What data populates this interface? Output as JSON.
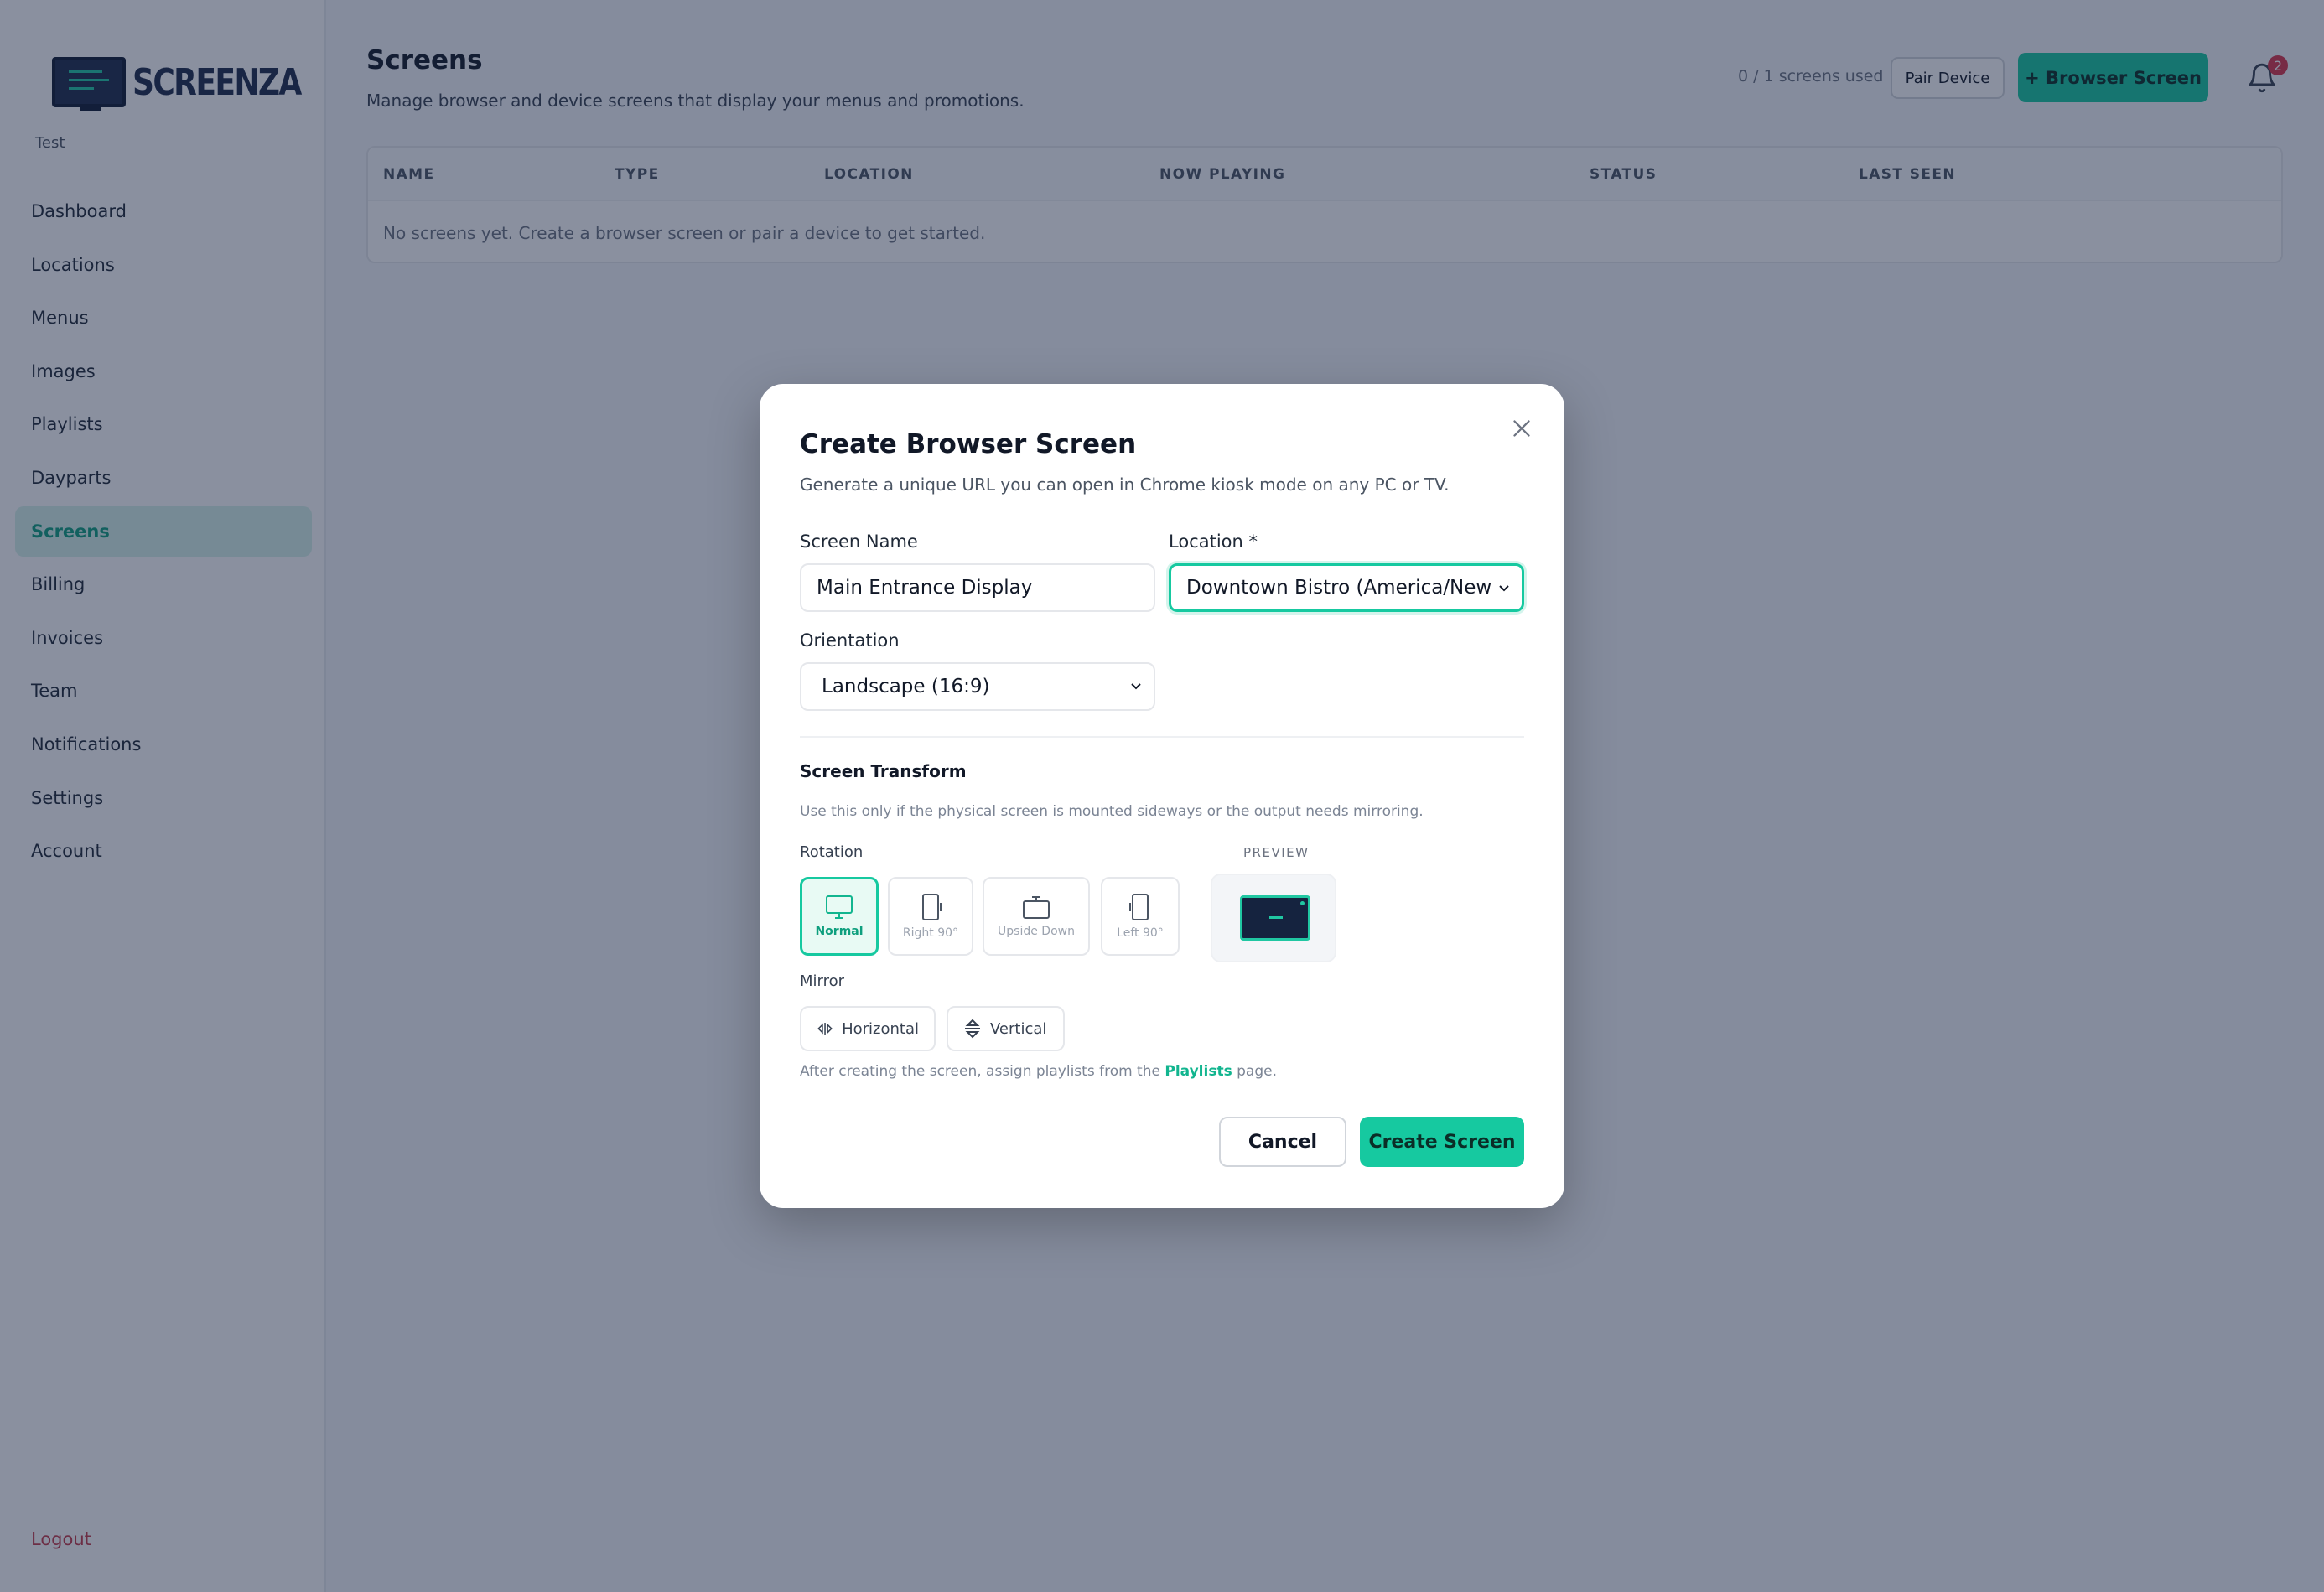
{
  "app": {
    "brand": "SCREENZA",
    "org_name": "Test",
    "accent_color": "#16c9a0"
  },
  "sidebar": {
    "items": [
      {
        "label": "Dashboard"
      },
      {
        "label": "Locations"
      },
      {
        "label": "Menus"
      },
      {
        "label": "Images"
      },
      {
        "label": "Playlists"
      },
      {
        "label": "Dayparts"
      },
      {
        "label": "Screens",
        "active": true
      },
      {
        "label": "Billing"
      },
      {
        "label": "Invoices"
      },
      {
        "label": "Team"
      },
      {
        "label": "Notifications"
      },
      {
        "label": "Settings"
      },
      {
        "label": "Account"
      }
    ],
    "logout": "Logout"
  },
  "header": {
    "title": "Screens",
    "subtitle": "Manage browser and device screens that display your menus and promotions.",
    "usage": "0 / 1 screens used",
    "pair_device": "Pair Device",
    "browser_screen": "+ Browser Screen",
    "notification_count": "2"
  },
  "table": {
    "columns": [
      "NAME",
      "TYPE",
      "LOCATION",
      "NOW PLAYING",
      "STATUS",
      "LAST SEEN"
    ],
    "empty_message": "No screens yet. Create a browser screen or pair a device to get started."
  },
  "modal": {
    "title": "Create Browser Screen",
    "subtitle": "Generate a unique URL you can open in Chrome kiosk mode on any PC or TV.",
    "screen_name_label": "Screen Name",
    "screen_name_value": "Main Entrance Display",
    "location_label": "Location *",
    "location_value": "Downtown Bistro (America/New",
    "orientation_label": "Orientation",
    "orientation_value": "Landscape (16:9)",
    "transform_title": "Screen Transform",
    "transform_help": "Use this only if the physical screen is mounted sideways or the output needs mirroring.",
    "rotation_label": "Rotation",
    "rotations": [
      {
        "label": "Normal",
        "selected": true
      },
      {
        "label": "Right 90°"
      },
      {
        "label": "Upside Down"
      },
      {
        "label": "Left 90°"
      }
    ],
    "preview_label": "PREVIEW",
    "mirror_label": "Mirror",
    "mirror_options": [
      "Horizontal",
      "Vertical"
    ],
    "footnote_prefix": "After creating the screen, assign playlists from the ",
    "footnote_link": "Playlists",
    "footnote_suffix": " page.",
    "cancel": "Cancel",
    "create": "Create Screen"
  }
}
